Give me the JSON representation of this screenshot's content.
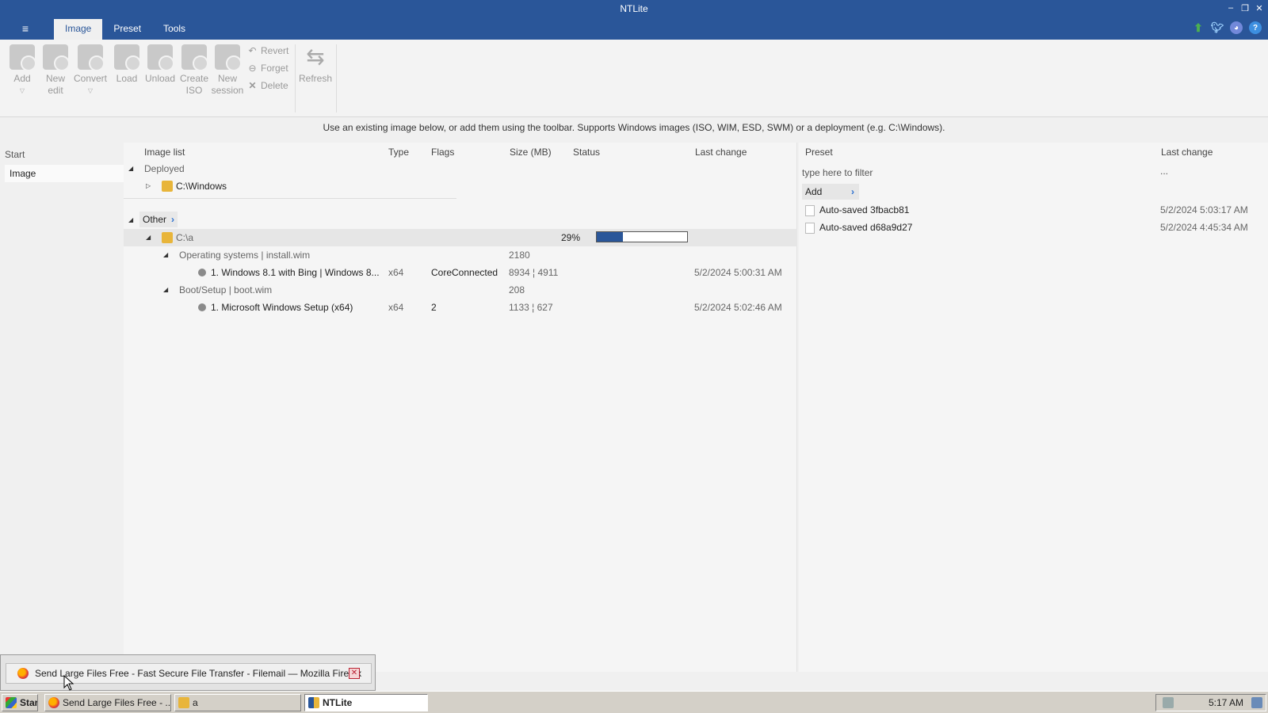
{
  "window": {
    "title": "NTLite",
    "tabs": [
      "Image",
      "Preset",
      "Tools"
    ],
    "active_tab": "Image"
  },
  "ribbon": {
    "buttons": {
      "add": "Add",
      "new_edit_1": "New",
      "new_edit_2": "edit",
      "convert": "Convert",
      "load": "Load",
      "unload": "Unload",
      "create_iso_1": "Create",
      "create_iso_2": "ISO",
      "new_session_1": "New",
      "new_session_2": "session",
      "revert": "Revert",
      "forget": "Forget",
      "delete": "Delete",
      "refresh": "Refresh"
    }
  },
  "info_text": "Use an existing image below, or add them using the toolbar. Supports Windows images (ISO, WIM, ESD, SWM) or a deployment (e.g. C:\\Windows).",
  "leftnav": {
    "header": "Start",
    "items": [
      "Image"
    ]
  },
  "image_list": {
    "columns": {
      "name": "Image list",
      "type": "Type",
      "flags": "Flags",
      "size": "Size (MB)",
      "status": "Status",
      "last_change": "Last change"
    },
    "deployed_group": "Deployed",
    "deployed_item": "C:\\Windows",
    "other_group": "Other",
    "folder": {
      "name": "C:\\a",
      "progress_text": "29%",
      "progress": 0.29
    },
    "os_group": {
      "label": "Operating systems  |  install.wim",
      "size": "2180"
    },
    "os_item": {
      "name": "1. Windows 8.1 with Bing  |  Windows 8...",
      "type": "x64",
      "flags": "CoreConnected",
      "size": "8934 ¦ 4911",
      "last_change": "5/2/2024 5:00:31 AM"
    },
    "boot_group": {
      "label": "Boot/Setup  |  boot.wim",
      "size": "208"
    },
    "boot_item": {
      "name": "1. Microsoft Windows Setup (x64)",
      "type": "x64",
      "flags": "2",
      "size": "1133 ¦ 627",
      "last_change": "5/2/2024 5:02:46 AM"
    }
  },
  "preset_panel": {
    "columns": {
      "preset": "Preset",
      "last_change": "Last change"
    },
    "filter_placeholder": "type here to filter",
    "filter_more": "...",
    "add_label": "Add",
    "items": [
      {
        "name": "Auto-saved 3fbacb81",
        "date": "5/2/2024 5:03:17 AM"
      },
      {
        "name": "Auto-saved d68a9d27",
        "date": "5/2/2024 4:45:34 AM"
      }
    ]
  },
  "taskbar_popup": {
    "entry": "Send Large Files Free - Fast Secure File Transfer - Filemail — Mozilla Firefox"
  },
  "taskbar": {
    "start": "Start",
    "buttons": [
      "Send Large Files Free - ...",
      "a",
      "NTLite"
    ],
    "active": "NTLite",
    "clock": "5:17 AM"
  },
  "colors": {
    "accent": "#2a5699",
    "folder": "#e8b53a"
  }
}
